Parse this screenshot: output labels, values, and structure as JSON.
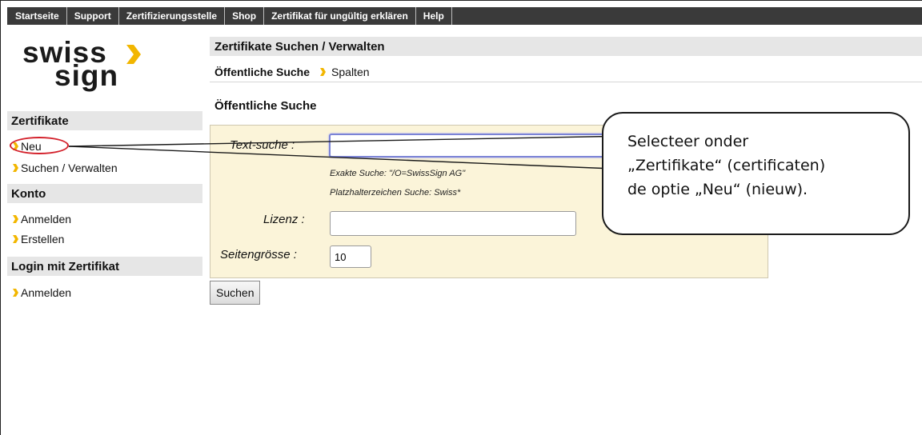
{
  "nav": {
    "tabs": [
      {
        "label": "Startseite"
      },
      {
        "label": "Support"
      },
      {
        "label": "Zertifizierungsstelle"
      },
      {
        "label": "Shop"
      },
      {
        "label": "Zertifikat für ungültig erklären"
      },
      {
        "label": "Help"
      }
    ]
  },
  "logo": {
    "line1": "swiss",
    "line2": "sign"
  },
  "sidebar": {
    "zertifikate": {
      "title": "Zertifikate",
      "items": [
        "Neu",
        "Suchen / Verwalten"
      ]
    },
    "konto": {
      "title": "Konto",
      "items": [
        "Anmelden",
        "Erstellen"
      ]
    },
    "login": {
      "title": "Login mit Zertifikat",
      "items": [
        "Anmelden"
      ]
    }
  },
  "main": {
    "title": "Zertifikate Suchen / Verwalten",
    "breadcrumb": {
      "active": "Öffentliche Suche",
      "next": "Spalten"
    },
    "section_title": "Öffentliche Suche",
    "form": {
      "text_label": "Text-suche :",
      "text_value": "",
      "hint_exact": "Exakte Suche: \"/O=SwissSign AG\"",
      "hint_wildcard": "Platzhalterzeichen Suche: Swiss*",
      "lizenz_label": "Lizenz :",
      "lizenz_value": "",
      "page_size_label": "Seitengrösse :",
      "page_size_value": "10"
    },
    "search_button": "Suchen"
  },
  "callout": {
    "line1": "Selecteer onder",
    "line2": "„Zertifikate“ (certificaten)",
    "line3": "de optie „Neu“ (nieuw)."
  },
  "colors": {
    "accent": "#f2b600",
    "nav_bg": "#3a3a3a",
    "panel_bg": "#fbf4d9",
    "highlight_circle": "#d3202a"
  }
}
